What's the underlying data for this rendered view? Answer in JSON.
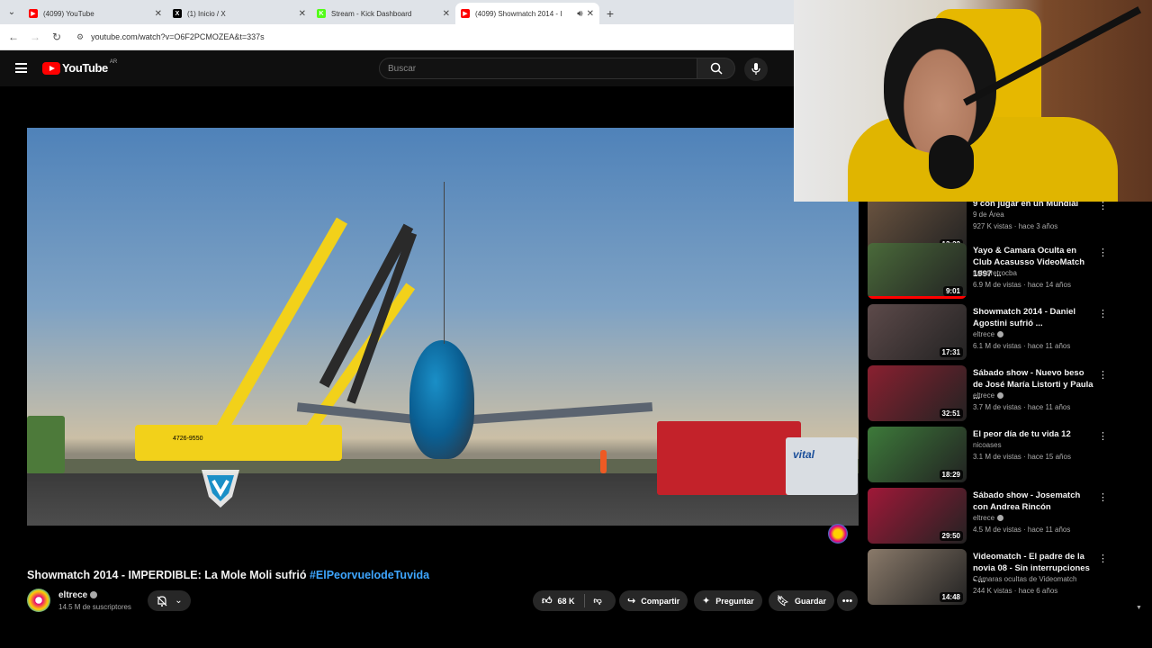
{
  "browser": {
    "tabs": [
      {
        "title": "(4099) YouTube",
        "fav_color": "#ff0000",
        "fav_glyph": "▶",
        "active": false
      },
      {
        "title": "(1) Inicio / X",
        "fav_color": "#000000",
        "fav_glyph": "X",
        "active": false
      },
      {
        "title": "Stream - Kick Dashboard",
        "fav_color": "#53fc18",
        "fav_glyph": "K",
        "active": false
      },
      {
        "title": "(4099) Showmatch 2014 - I",
        "fav_color": "#ff0000",
        "fav_glyph": "▶",
        "active": true
      }
    ],
    "url": "youtube.com/watch?v=O6F2PCMOZEA&t=337s"
  },
  "header": {
    "logo_text": "YouTube",
    "region": "AR",
    "search_placeholder": "Buscar"
  },
  "video": {
    "title": "Showmatch 2014 - IMPERDIBLE: La Mole Moli sufrió ",
    "hashtag": "#ElPeorvuelodeTuvida",
    "truck_text": "4726-9550",
    "sign_text": "vital",
    "channel": "eltrece",
    "subscribers": "14.5 M de suscriptores",
    "likes": "68 K",
    "share_label": "Compartir",
    "ask_label": "Preguntar",
    "save_label": "Guardar"
  },
  "recommendations": [
    {
      "title": "9 con jugar en un Mundial",
      "channel": "9 de Área",
      "meta": "927 K vistas · hace 3 años",
      "duration": "13:22",
      "thumb": "#6b5440",
      "verified": false,
      "progress": 0
    },
    {
      "title": "Yayo & Camara Oculta en Club Acasusso VideoMatch 1997 ...",
      "channel": "futbolretrocba",
      "meta": "6.9 M de vistas · hace 14 años",
      "duration": "9:01",
      "thumb": "#4a6a3a",
      "verified": false,
      "progress": 1
    },
    {
      "title": "Showmatch 2014 - Daniel Agostini sufrió ...",
      "channel": "eltrece",
      "meta": "6.1 M de vistas · hace 11 años",
      "duration": "17:31",
      "thumb": "#5d4a4a",
      "verified": true,
      "progress": 0
    },
    {
      "title": "Sábado show - Nuevo beso de José María Listorti y Paula ...",
      "channel": "eltrece",
      "meta": "3.7 M de vistas · hace 11 años",
      "duration": "32:51",
      "thumb": "#8a2030",
      "verified": true,
      "progress": 0
    },
    {
      "title": "El peor día de tu vida 12",
      "channel": "nicoases",
      "meta": "3.1 M de vistas · hace 15 años",
      "duration": "18:29",
      "thumb": "#3d7a3a",
      "verified": false,
      "progress": 0
    },
    {
      "title": "Sábado show - Josematch con Andrea Rincón",
      "channel": "eltrece",
      "meta": "4.5 M de vistas · hace 11 años",
      "duration": "29:50",
      "thumb": "#a01838",
      "verified": true,
      "progress": 0
    },
    {
      "title": "Videomatch - El padre de la novia 08 - Sin interrupciones - ...",
      "channel": "Cámaras ocultas de Videomatch",
      "meta": "244 K vistas · hace 6 años",
      "duration": "14:48",
      "thumb": "#8a7a6a",
      "verified": false,
      "progress": 0
    }
  ]
}
